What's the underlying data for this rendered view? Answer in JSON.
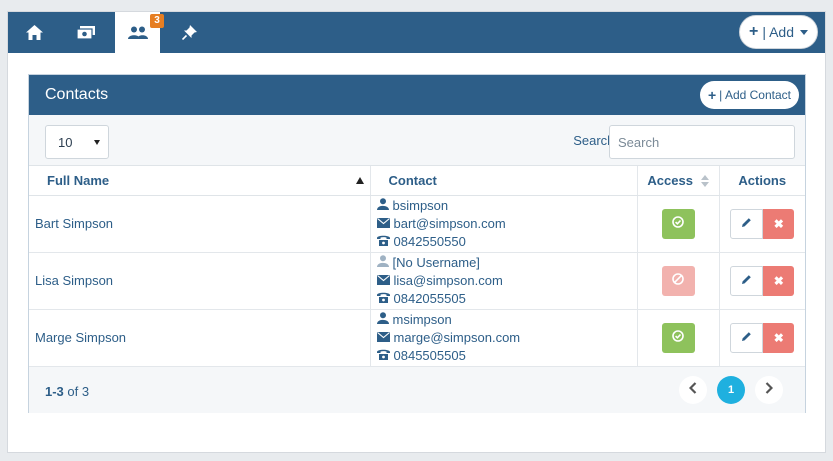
{
  "topbar": {
    "tabs": [
      {
        "icon": "home-icon"
      },
      {
        "icon": "money-icon"
      },
      {
        "icon": "users-icon",
        "badge": "3",
        "active": true
      },
      {
        "icon": "pin-icon"
      }
    ],
    "add_label": "| Add"
  },
  "panel": {
    "title": "Contacts",
    "add_contact_label": "| Add Contact"
  },
  "controls": {
    "page_size": "10",
    "search_label": "Search:",
    "search_placeholder": "Search"
  },
  "table": {
    "columns": [
      "Full Name",
      "Contact",
      "Access",
      "Actions"
    ],
    "rows": [
      {
        "name": "Bart Simpson",
        "username": "bsimpson",
        "email": "bart@simpson.com",
        "phone": "0842550550",
        "access": true
      },
      {
        "name": "Lisa Simpson",
        "username": "[No Username]",
        "email": "lisa@simpson.com",
        "phone": "0842055505",
        "access": false
      },
      {
        "name": "Marge Simpson",
        "username": "msimpson",
        "email": "marge@simpson.com",
        "phone": "0845505505",
        "access": true
      }
    ]
  },
  "footer": {
    "range": "1-3",
    "of_label": "of 3",
    "current_page": "1"
  },
  "colors": {
    "primary": "#2d5e88",
    "access_on": "#8ec25c",
    "access_off": "#f2b2ae",
    "delete": "#ec7b74",
    "page_active": "#1fb0df",
    "badge": "#e67e22"
  }
}
